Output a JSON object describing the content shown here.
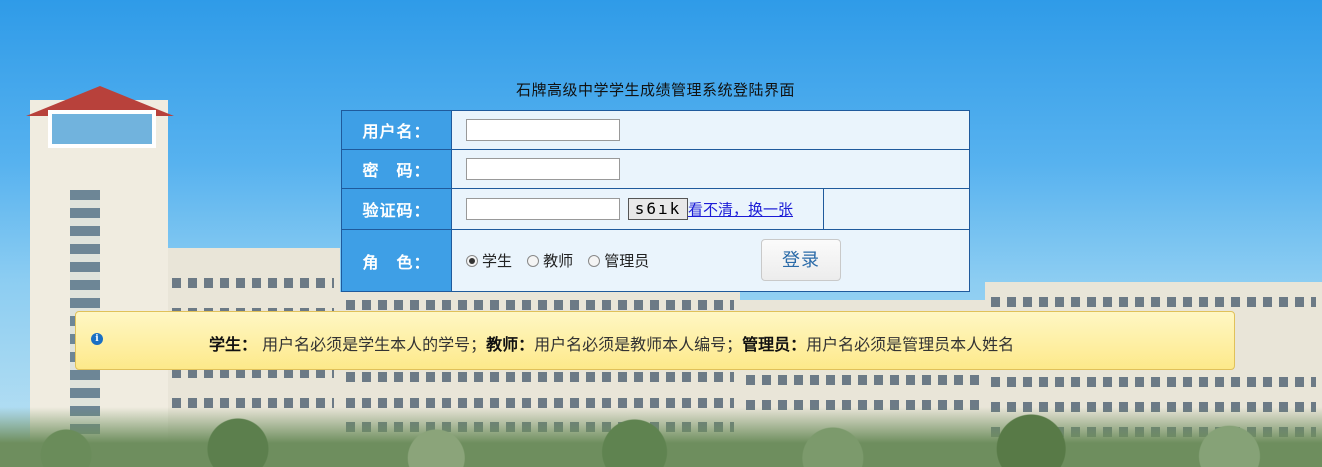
{
  "page": {
    "title": "石牌高级中学学生成绩管理系统登陆界面"
  },
  "form": {
    "username": {
      "label": "用户名：",
      "value": ""
    },
    "password": {
      "label": "密　码：",
      "value": ""
    },
    "captcha": {
      "label": "验证码：",
      "value": "",
      "image_text": "s6ık",
      "refresh_link": "看不清，换一张"
    },
    "role": {
      "label": "角　色：",
      "options": [
        {
          "label": "学生",
          "selected": true
        },
        {
          "label": "教师",
          "selected": false
        },
        {
          "label": "管理员",
          "selected": false
        }
      ]
    },
    "submit_label": "登录"
  },
  "notice": {
    "icon": "info-icon",
    "segments": [
      {
        "role": "学生：",
        "text": "用户名必须是学生本人的学号；"
      },
      {
        "role": "教师：",
        "text": "用户名必须是教师本人编号；"
      },
      {
        "role": "管理员：",
        "text": "用户名必须是管理员本人姓名"
      }
    ]
  },
  "colors": {
    "label_bg": "#3e9fe6",
    "table_border": "#1f5a9c",
    "notice_bg": "#fdf0a8",
    "link": "#1b1bd6"
  }
}
